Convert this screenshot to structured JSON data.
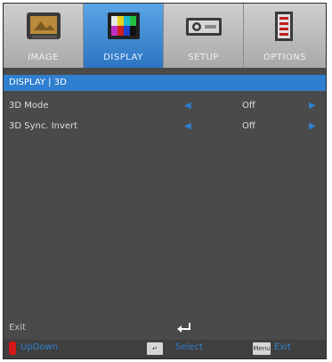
{
  "tabs": [
    {
      "label": "IMAGE",
      "icon": "image-icon",
      "active": false
    },
    {
      "label": "DISPLAY",
      "icon": "display-icon",
      "active": true
    },
    {
      "label": "SETUP",
      "icon": "setup-icon",
      "active": false
    },
    {
      "label": "OPTIONS",
      "icon": "options-icon",
      "active": false
    }
  ],
  "title": "DISPLAY | 3D",
  "rows": [
    {
      "label": "3D Mode",
      "value": "Off"
    },
    {
      "label": "3D Sync. Invert",
      "value": "Off"
    }
  ],
  "footer": {
    "exit_label": "Exit",
    "updown_label": "UpDown",
    "select_label": "Select",
    "exit_hint_label": "Exit",
    "menu_key_label": "Menu"
  },
  "colors": {
    "accent": "#2f7fd0",
    "updown_red": "#d01818"
  }
}
